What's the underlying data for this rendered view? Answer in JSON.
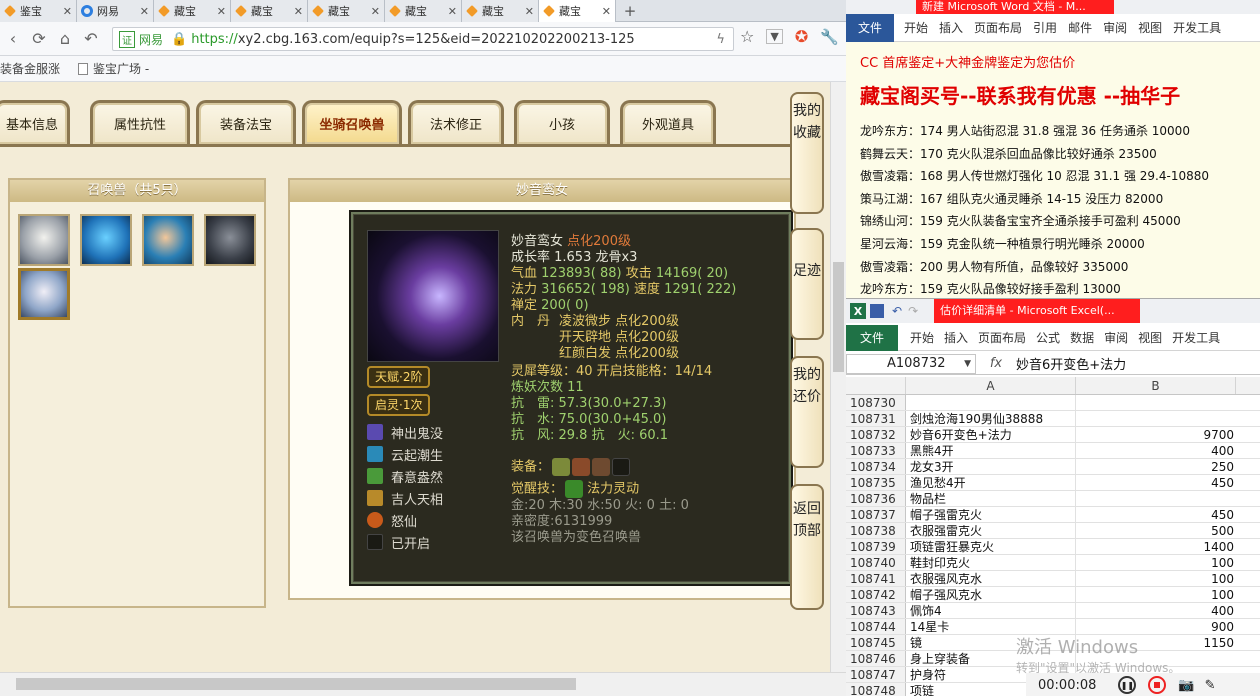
{
  "browser": {
    "tabs": [
      {
        "label": "鉴宝",
        "icon": "orange"
      },
      {
        "label": "网易",
        "icon": "blue"
      },
      {
        "label": "藏宝",
        "icon": "orange"
      },
      {
        "label": "藏宝",
        "icon": "orange"
      },
      {
        "label": "藏宝",
        "icon": "orange"
      },
      {
        "label": "藏宝",
        "icon": "orange"
      },
      {
        "label": "藏宝",
        "icon": "orange"
      },
      {
        "label": "藏宝",
        "icon": "orange"
      }
    ],
    "tab_close": "✕",
    "new_tab": "+",
    "cert_label": "证",
    "site_label": "网易",
    "url_protocol": "https://",
    "url_rest": "xy2.cbg.163.com/equip?s=125&eid=202210202200213-125",
    "bookmarks": [
      "装备金服涨",
      "鉴宝广场 -"
    ]
  },
  "page": {
    "tabs": [
      "基本信息",
      "属性抗性",
      "装备法宝",
      "坐骑召唤兽",
      "法术修正",
      "小孩",
      "外观道具"
    ],
    "active_tab": "坐骑召唤兽",
    "left_panel_title": "召唤兽（共5只）",
    "main_panel_title": "妙音鸾女",
    "side_buttons": [
      "我的收藏",
      "足迹",
      "我的还价",
      "返回顶部"
    ],
    "pet": {
      "name": "妙音鸾女",
      "name_suffix": "点化200级",
      "growth": "成长率 1.653 龙骨x3",
      "hp_label": "气血",
      "hp_value": "123893( 88)",
      "atk_label": "攻击",
      "atk_value": "14169( 20)",
      "mp_label": "法力",
      "mp_value": "316652( 198)",
      "spd_label": "速度",
      "spd_value": "1291( 222)",
      "zen_label": "禅定",
      "zen_value": "200( 0)",
      "neidan_label": "内　丹",
      "neidan": [
        "凌波微步 点化200级",
        "开天辟地 点化200级",
        "红颜白发 点化200级"
      ],
      "lingxi": "灵犀等级：40 开启技能格：14/14",
      "lianyao": "炼妖次数 11",
      "resist1": "抗　雷: 57.3(30.0+27.3)",
      "resist2": "抗　水: 75.0(30.0+45.0)",
      "resist3": "抗　风: 29.8 抗　火: 60.1",
      "equip_label": "装备：",
      "awaken_label": "觉醒技：",
      "awaken_skill": "法力灵动",
      "elements": "金:20 木:30 水:50 火: 0 土: 0",
      "intimacy": "亲密度:6131999",
      "note": "该召唤兽为变色召唤兽",
      "talent": "天赋·2阶",
      "qiling": "启灵·1次",
      "skills": [
        "神出鬼没",
        "云起潮生",
        "春意盎然",
        "吉人天相",
        "怒仙",
        "已开启"
      ]
    }
  },
  "word": {
    "title": "新建 Microsoft Word 文档 - M...",
    "file": "文件",
    "ribbon": [
      "开始",
      "插入",
      "页面布局",
      "引用",
      "邮件",
      "审阅",
      "视图",
      "开发工具"
    ],
    "lines": [
      "CC 首席鉴定+大神金牌鉴定为您估价",
      "藏宝阁买号--联系我有优惠 --抽华子",
      "龙吟东方：174 男人站街忍混 31.8 强混 36 任务通杀 10000",
      "鹤舞云天：170 克火队混杀回血品像比较好通杀 23500",
      "傲雪凌霜：168 男人传世燃灯强化 10 忍混 31.1 强 29.4-10880",
      "策马江湖：167 组队克火通灵睡杀 14-15 没压力 82000",
      "锦绣山河：159 克火队装备宝宝齐全通杀接手可盈利 45000",
      "星河云海：159 克金队统一种植景行明光睡杀 20000",
      "傲雪凌霜：200 男人物有所值，品像较好 335000",
      "龙吟东方：159 克火队品像较好接手盈利 13000"
    ]
  },
  "excel": {
    "title": "估价详细清单 - Microsoft Excel(...",
    "file": "文件",
    "ribbon": [
      "开始",
      "插入",
      "页面布局",
      "公式",
      "数据",
      "审阅",
      "视图",
      "开发工具"
    ],
    "namebox": "A108732",
    "fx": "fx",
    "formula": "妙音6开变色+法力",
    "col_a": "A",
    "col_b": "B",
    "rows": [
      {
        "n": "108730",
        "a": "",
        "b": ""
      },
      {
        "n": "108731",
        "a": "剑烛沧海190男仙38888",
        "b": ""
      },
      {
        "n": "108732",
        "a": "妙音6开变色+法力",
        "b": "9700"
      },
      {
        "n": "108733",
        "a": "黑熊4开",
        "b": "400"
      },
      {
        "n": "108734",
        "a": "龙女3开",
        "b": "250"
      },
      {
        "n": "108735",
        "a": "渔见愁4开",
        "b": "450"
      },
      {
        "n": "108736",
        "a": "物品栏",
        "b": ""
      },
      {
        "n": "108737",
        "a": "帽子强雷克火",
        "b": "450"
      },
      {
        "n": "108738",
        "a": "衣服强雷克火",
        "b": "500"
      },
      {
        "n": "108739",
        "a": "项链雷狂暴克火",
        "b": "1400"
      },
      {
        "n": "108740",
        "a": "鞋封印克火",
        "b": "100"
      },
      {
        "n": "108741",
        "a": "衣服强风克水",
        "b": "100"
      },
      {
        "n": "108742",
        "a": "帽子强风克水",
        "b": "100"
      },
      {
        "n": "108743",
        "a": "佩饰4",
        "b": "400"
      },
      {
        "n": "108744",
        "a": "14星卡",
        "b": "900"
      },
      {
        "n": "108745",
        "a": "镜",
        "b": "1150"
      },
      {
        "n": "108746",
        "a": "身上穿装备",
        "b": ""
      },
      {
        "n": "108747",
        "a": "护身符",
        "b": ""
      },
      {
        "n": "108748",
        "a": "项链",
        "b": ""
      }
    ],
    "activation": "激活 Windows",
    "activation_hint": "转到\"设置\"以激活 Windows。",
    "timer": "00:00:08"
  }
}
